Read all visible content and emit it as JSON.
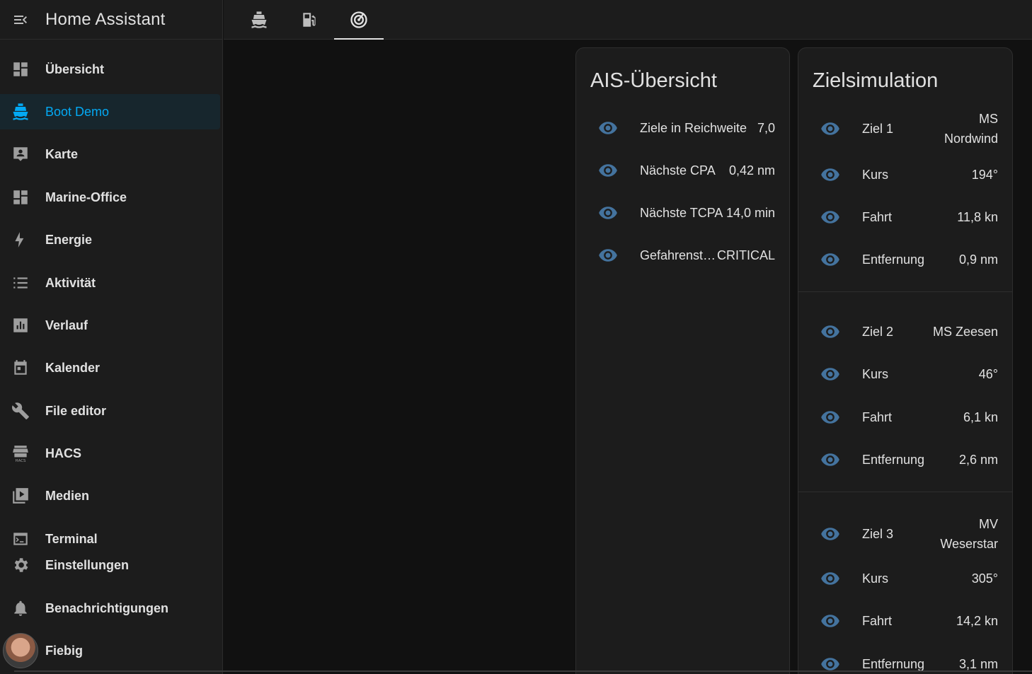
{
  "app": {
    "title": "Home Assistant"
  },
  "sidebar": {
    "items": [
      {
        "label": "Übersicht",
        "icon": "dashboard-icon"
      },
      {
        "label": "Boot Demo",
        "icon": "ferry-icon",
        "active": true
      },
      {
        "label": "Karte",
        "icon": "map-account-icon"
      },
      {
        "label": "Marine-Office",
        "icon": "dashboard-icon"
      },
      {
        "label": "Energie",
        "icon": "lightning-icon"
      },
      {
        "label": "Aktivität",
        "icon": "list-icon"
      },
      {
        "label": "Verlauf",
        "icon": "chart-box-icon"
      },
      {
        "label": "Kalender",
        "icon": "calendar-icon"
      },
      {
        "label": "File editor",
        "icon": "wrench-icon"
      },
      {
        "label": "HACS",
        "icon": "hacs-icon"
      },
      {
        "label": "Medien",
        "icon": "play-box-icon"
      },
      {
        "label": "Terminal",
        "icon": "console-icon"
      },
      {
        "label": "Einstellungen",
        "icon": "gear-icon"
      },
      {
        "label": "Benachrichtigungen",
        "icon": "bell-icon"
      },
      {
        "label": "Fiebig",
        "icon": "avatar"
      }
    ]
  },
  "tabs": [
    {
      "icon": "ferry-icon"
    },
    {
      "icon": "gas-station-icon"
    },
    {
      "icon": "radar-icon",
      "active": true
    }
  ],
  "ais_card": {
    "title": "AIS-Übersicht",
    "rows": [
      {
        "name": "Ziele in Reichweite",
        "value": "7,0"
      },
      {
        "name": "Nächste CPA",
        "value": "0,42 nm"
      },
      {
        "name": "Nächste TCPA",
        "value": "14,0 min"
      },
      {
        "name": "Gefahrenst…",
        "value": "CRITICAL"
      }
    ]
  },
  "sim_card": {
    "title": "Zielsimulation",
    "targets": [
      {
        "ziel": {
          "name": "Ziel 1",
          "value_line1": "MS",
          "value_line2": "Nordwind"
        },
        "kurs": {
          "name": "Kurs",
          "value": "194°"
        },
        "fahrt": {
          "name": "Fahrt",
          "value": "11,8 kn"
        },
        "entf": {
          "name": "Entfernung",
          "value": "0,9 nm"
        }
      },
      {
        "ziel": {
          "name": "Ziel 2",
          "value_line1": "MS Zeesen",
          "value_line2": ""
        },
        "kurs": {
          "name": "Kurs",
          "value": "46°"
        },
        "fahrt": {
          "name": "Fahrt",
          "value": "6,1 kn"
        },
        "entf": {
          "name": "Entfernung",
          "value": "2,6 nm"
        }
      },
      {
        "ziel": {
          "name": "Ziel 3",
          "value_line1": "MV",
          "value_line2": "Weserstar"
        },
        "kurs": {
          "name": "Kurs",
          "value": "305°"
        },
        "fahrt": {
          "name": "Fahrt",
          "value": "14,2 kn"
        },
        "entf": {
          "name": "Entfernung",
          "value": "3,1 nm"
        }
      }
    ]
  },
  "colors": {
    "accent": "#03a9f4",
    "eye_icon": "#44739e",
    "sidebar_bg": "#1c1c1c",
    "page_bg": "#111111",
    "card_bg": "#1c1c1c"
  }
}
